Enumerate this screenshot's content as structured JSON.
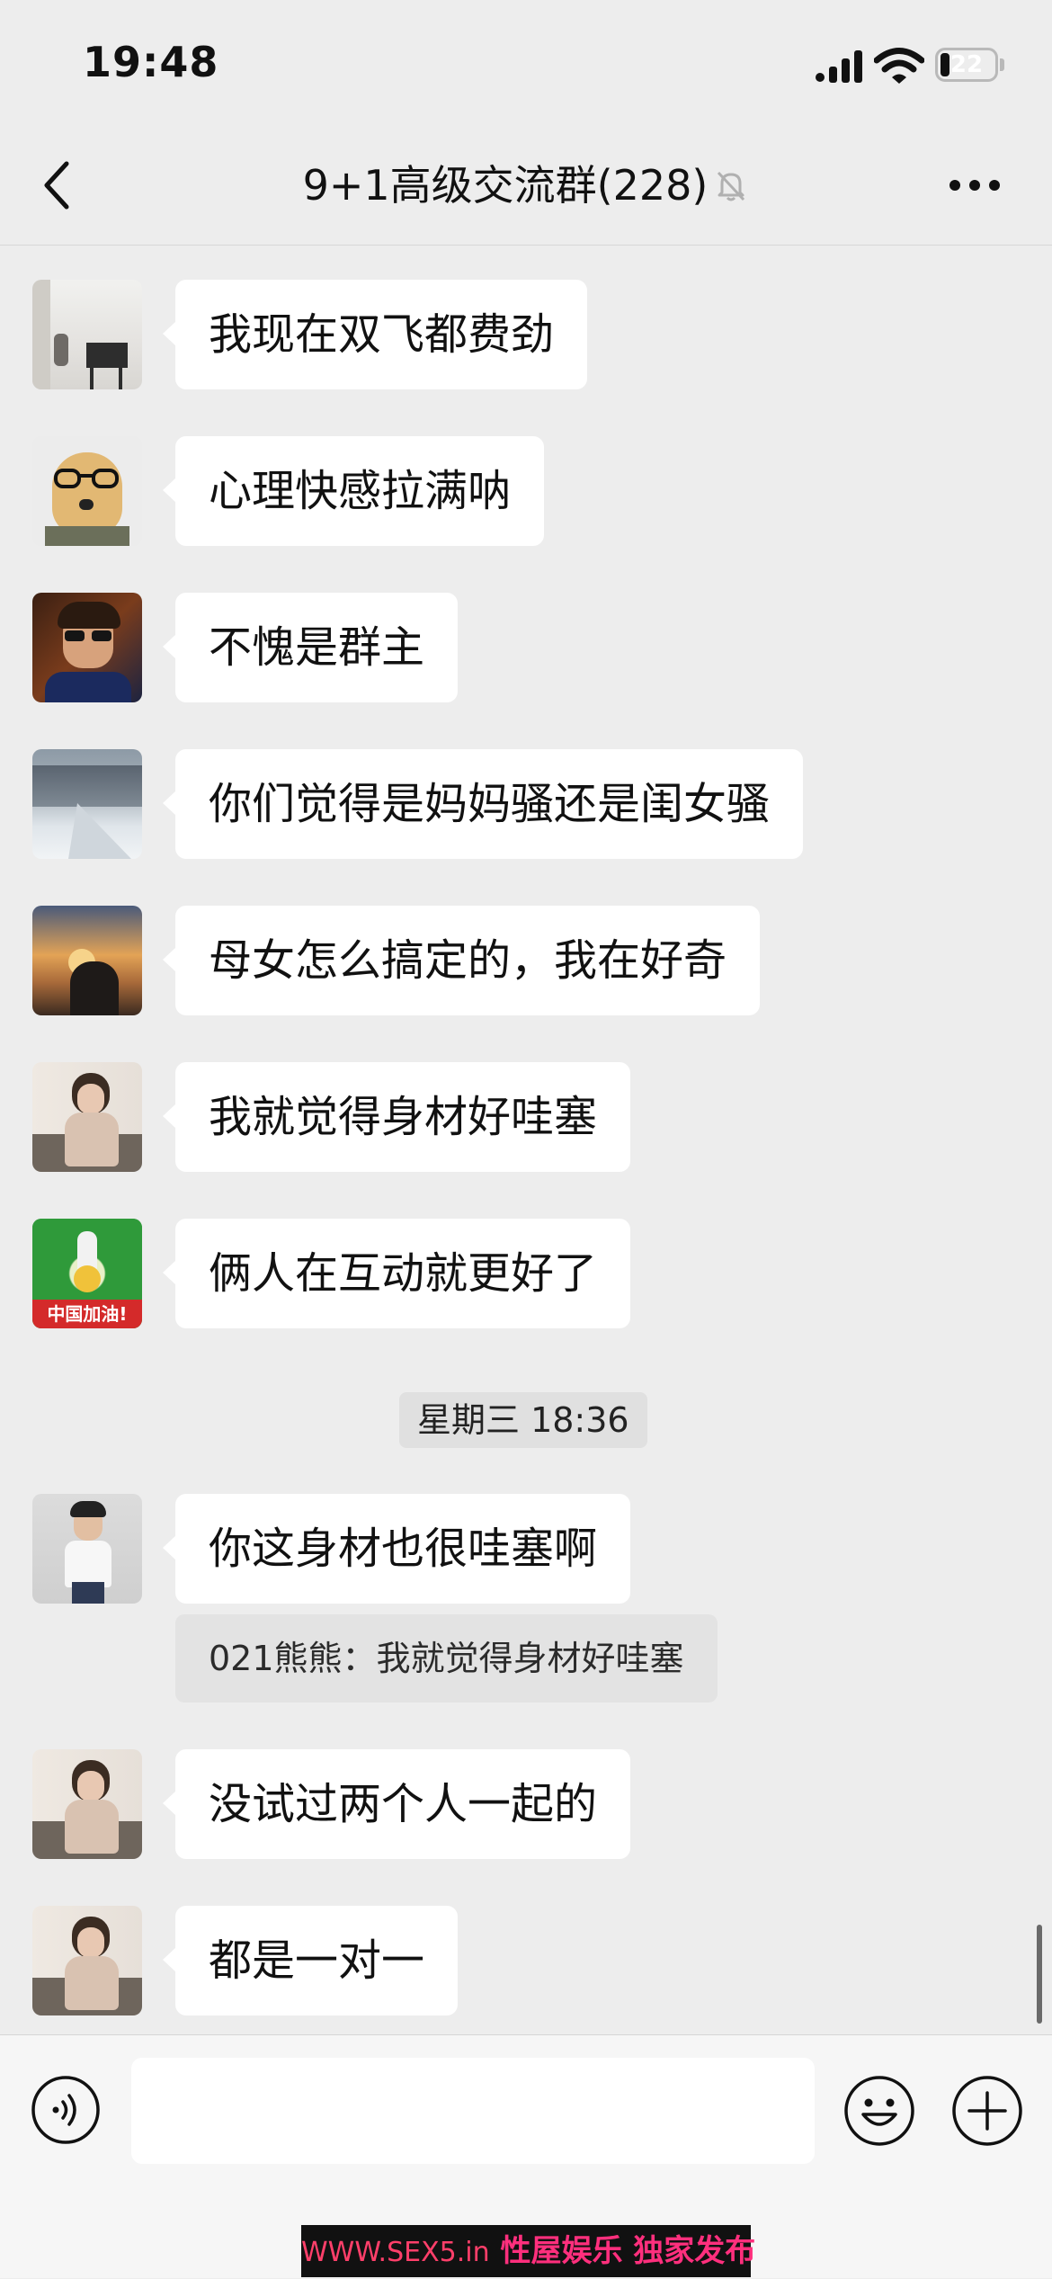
{
  "status_bar": {
    "time": "19:48",
    "battery": "22"
  },
  "nav": {
    "title": "9+1高级交流群(228)"
  },
  "messages": [
    {
      "text": "我现在双飞都费劲"
    },
    {
      "text": "心理快感拉满呐"
    },
    {
      "text": "不愧是群主"
    },
    {
      "text": "你们觉得是妈妈骚还是闺女骚"
    },
    {
      "text": "母女怎么搞定的，我在好奇"
    },
    {
      "text": "我就觉得身材好哇塞"
    },
    {
      "text": "俩人在互动就更好了",
      "avatar_badge": "中国加油!"
    },
    {
      "text": "你这身材也很哇塞啊",
      "quote": "021熊熊：我就觉得身材好哇塞"
    },
    {
      "text": "没试过两个人一起的"
    },
    {
      "text": "都是一对一"
    }
  ],
  "timestamp": "星期三 18:36",
  "input": {
    "value": ""
  },
  "watermark": {
    "url": "WWW.SEX5.in",
    "text": "性屋娱乐 独家发布"
  },
  "colors": {
    "background": "#ededed",
    "bubble": "#ffffff",
    "quote_bg": "#e3e3e3",
    "input_bar": "#f6f6f6",
    "watermark_text": "#ff2f7d"
  },
  "icons": [
    "back-chevron-icon",
    "mute-bell-icon",
    "more-dots-icon",
    "voice-icon",
    "emoji-icon",
    "plus-icon",
    "signal-icon",
    "wifi-icon",
    "battery-icon"
  ]
}
